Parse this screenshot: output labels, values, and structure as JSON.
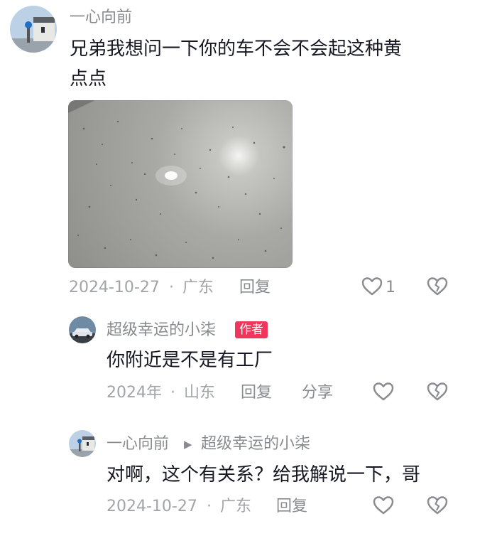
{
  "comments": [
    {
      "username": "一心向前",
      "text_line1": "兄弟我想问一下你的车不会不会起这种黄",
      "text_line2": "点点",
      "date": "2024-10-27",
      "separator": "·",
      "location": "广东",
      "reply_label": "回复",
      "like_count": "1",
      "icons": {
        "like": "heart-outline-icon",
        "dislike": "broken-heart-icon"
      }
    },
    {
      "username": "超级幸运的小柒",
      "author_badge": "作者",
      "text": "你附近是不是有工厂",
      "date": "2024年",
      "separator": "·",
      "location": "山东",
      "reply_label": "回复",
      "share_label": "分享",
      "icons": {
        "like": "heart-outline-icon",
        "dislike": "broken-heart-icon"
      }
    },
    {
      "username": "一心向前",
      "reply_to_arrow": "▶",
      "reply_to_name": "超级幸运的小柒",
      "text": "对啊，这个有关系？给我解说一下，哥",
      "date": "2024-10-27",
      "separator": "·",
      "location": "广东",
      "reply_label": "回复",
      "icons": {
        "like": "heart-outline-icon",
        "dislike": "broken-heart-icon"
      }
    }
  ],
  "colors": {
    "text_primary": "#161823",
    "text_secondary": "#8a8b91",
    "text_meta": "#a3a4a8",
    "author_badge": "#f0365a",
    "icon_gray": "#8a8b91"
  }
}
